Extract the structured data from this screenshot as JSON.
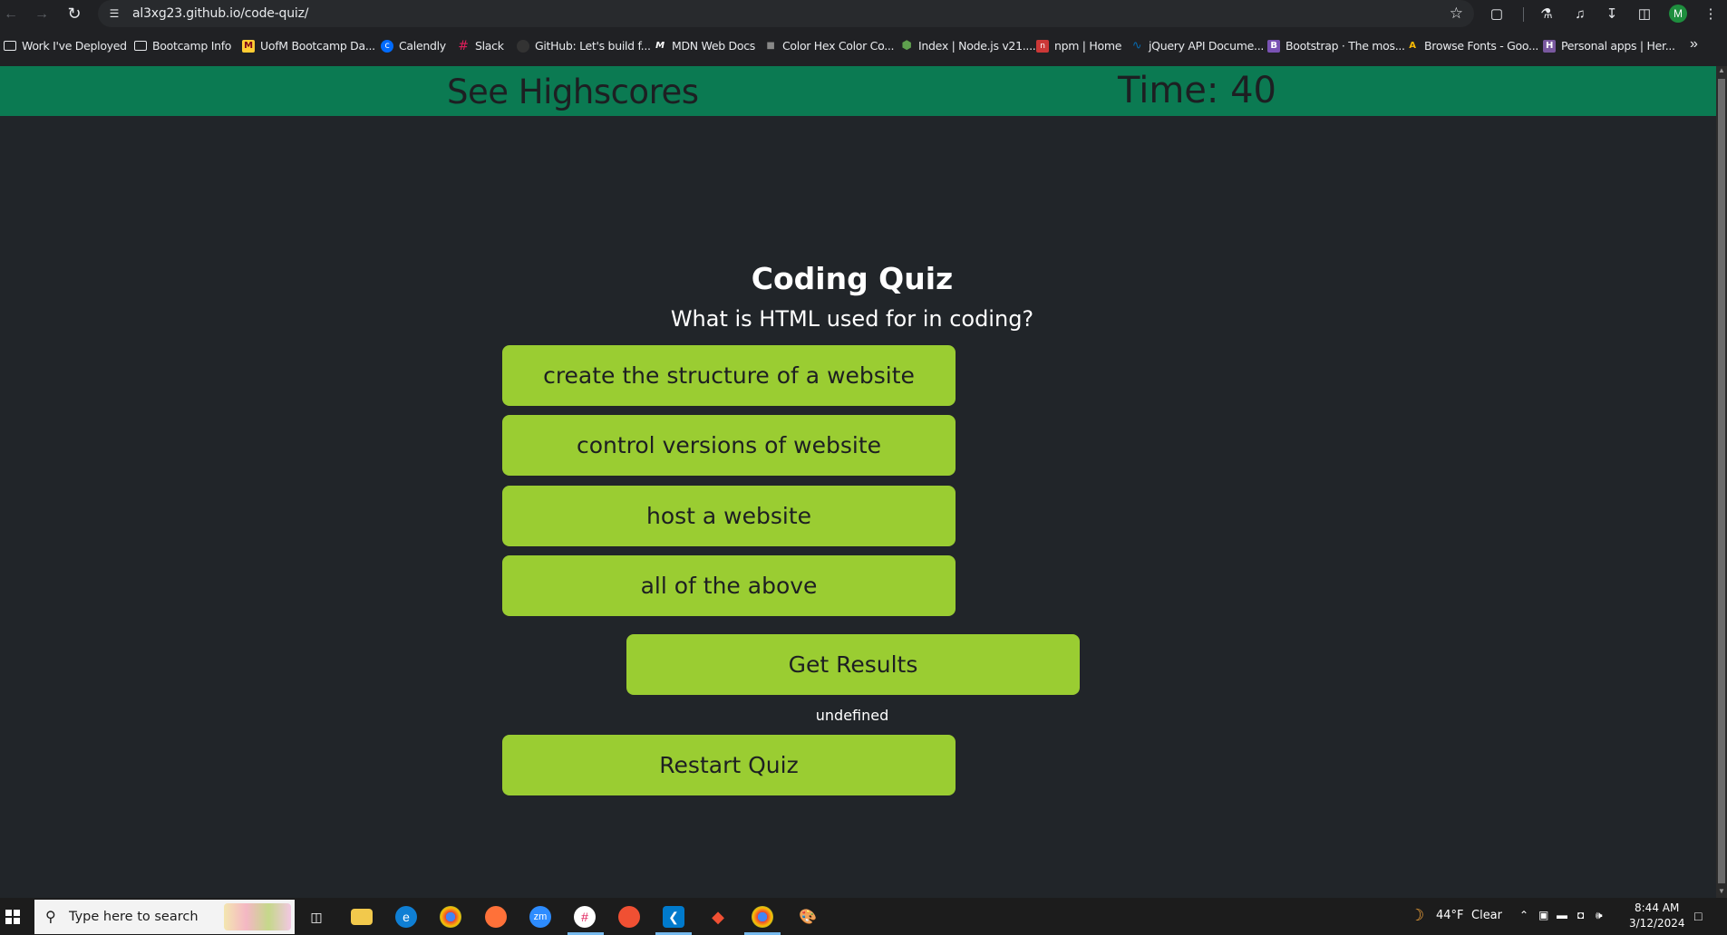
{
  "browser": {
    "url": "al3xg23.github.io/code-quiz/",
    "profile_initial": "M"
  },
  "bookmarks": [
    {
      "label": "Work I've Deployed",
      "icon": "folder-icon"
    },
    {
      "label": "Bootcamp Info",
      "icon": "folder-icon"
    },
    {
      "label": "UofM Bootcamp Da...",
      "icon": "umn-logo-icon"
    },
    {
      "label": "Calendly",
      "icon": "calendly-icon"
    },
    {
      "label": "Slack",
      "icon": "slack-icon"
    },
    {
      "label": "GitHub: Let's build f...",
      "icon": "github-icon"
    },
    {
      "label": "MDN Web Docs",
      "icon": "mdn-icon"
    },
    {
      "label": "Color Hex Color Co...",
      "icon": "colorhex-icon"
    },
    {
      "label": "Index | Node.js v21....",
      "icon": "nodejs-icon"
    },
    {
      "label": "npm | Home",
      "icon": "npm-icon"
    },
    {
      "label": "jQuery API Docume...",
      "icon": "jquery-icon"
    },
    {
      "label": "Bootstrap · The mos...",
      "icon": "bootstrap-icon"
    },
    {
      "label": "Browse Fonts - Goo...",
      "icon": "google-fonts-icon"
    },
    {
      "label": "Personal apps | Her...",
      "icon": "heroku-icon"
    }
  ],
  "header": {
    "highscores_label": "See Highscores",
    "timer_label": "Time: 40"
  },
  "quiz": {
    "title": "Coding Quiz",
    "question": "What is HTML used for in coding?",
    "answers": [
      "create the structure of a website",
      "control versions of website",
      "host a website",
      "all of the above"
    ],
    "results_label": "Get Results",
    "feedback": "undefined",
    "restart_label": "Restart Quiz"
  },
  "colors": {
    "header_bg": "#0b7a52",
    "button_bg": "#9acd32",
    "page_bg": "#212529"
  },
  "taskbar": {
    "search_placeholder": "Type here to search",
    "weather_temp": "44°F",
    "weather_cond": "Clear",
    "time": "8:44 AM",
    "date": "3/12/2024"
  }
}
